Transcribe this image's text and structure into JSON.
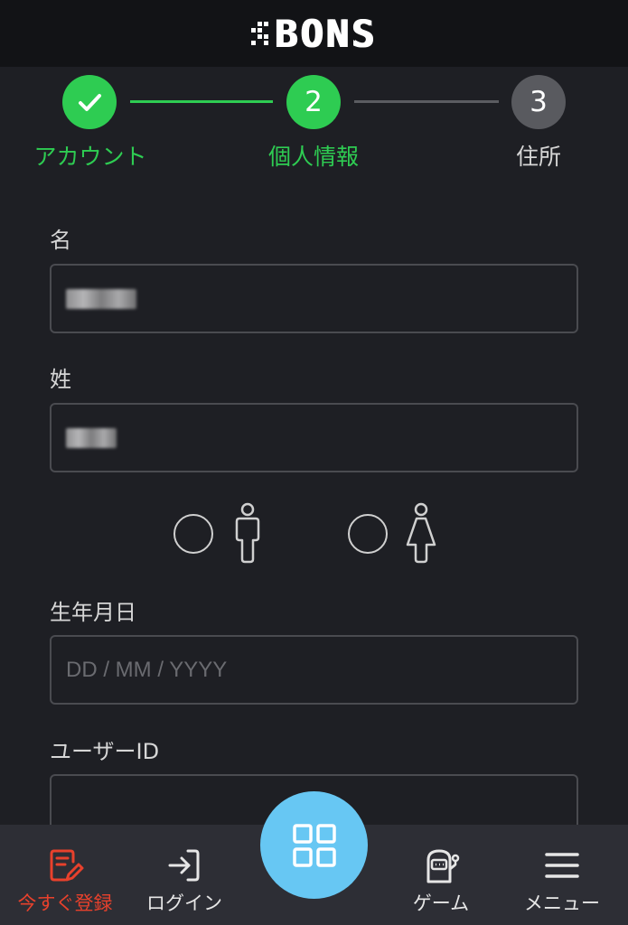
{
  "header": {
    "logo_text": "BONS"
  },
  "stepper": {
    "steps": [
      {
        "number": "1",
        "label": "アカウント",
        "state": "done"
      },
      {
        "number": "2",
        "label": "個人情報",
        "state": "active"
      },
      {
        "number": "3",
        "label": "住所",
        "state": "pending"
      }
    ],
    "colors": {
      "active": "#2ecc52",
      "pending": "#595a5f",
      "line_pending": "#5b5c61"
    }
  },
  "form": {
    "first_name": {
      "label": "名",
      "value": ""
    },
    "last_name": {
      "label": "姓",
      "value": ""
    },
    "gender": {
      "options": [
        "male-icon",
        "female-icon"
      ]
    },
    "birthdate": {
      "label": "生年月日",
      "placeholder": "DD / MM / YYYY"
    },
    "user_id": {
      "label": "ユーザーID",
      "value": ""
    }
  },
  "bottom_nav": {
    "items": [
      {
        "label": "今すぐ登録",
        "icon": "edit-document-icon",
        "color": "#e8412c"
      },
      {
        "label": "ログイン",
        "icon": "login-icon"
      },
      {
        "label": "",
        "icon": "grid-icon"
      },
      {
        "label": "ゲーム",
        "icon": "slot-machine-icon"
      },
      {
        "label": "メニュー",
        "icon": "hamburger-menu-icon"
      }
    ]
  }
}
